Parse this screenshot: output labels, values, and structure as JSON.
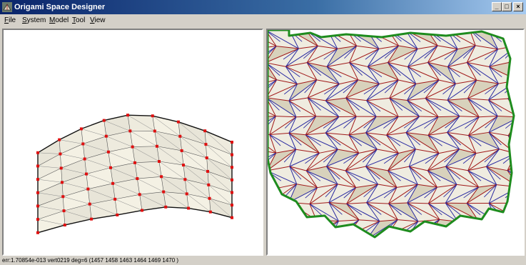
{
  "window": {
    "title": "Origami Space Designer",
    "buttons": {
      "minimize": "_",
      "maximize": "□",
      "close": "×"
    }
  },
  "menu": {
    "items": [
      {
        "id": "file",
        "mnemonic": "F",
        "rest": "ile"
      },
      {
        "id": "system",
        "mnemonic": "S",
        "rest": "ystem"
      },
      {
        "id": "model",
        "mnemonic": "M",
        "rest": "odel"
      },
      {
        "id": "tool",
        "mnemonic": "T",
        "rest": "ool"
      },
      {
        "id": "view",
        "mnemonic": "V",
        "rest": "iew"
      }
    ]
  },
  "left_view": {
    "description": "3D folded model mesh with red vertex markers"
  },
  "right_view": {
    "description": "2D crease pattern with green boundary, red and blue crease lines"
  },
  "status": {
    "text": "err:1.70854e-013 vert0219 deg=6 (1457 1458 1463 1464 1469 1470 )"
  },
  "colors": {
    "title_start": "#0a246a",
    "title_end": "#a6caf0",
    "mountain": "#a01818",
    "valley": "#2a2aa0",
    "boundary": "#1e8c1e",
    "vertex": "#e01010",
    "paper": "#efece0"
  }
}
